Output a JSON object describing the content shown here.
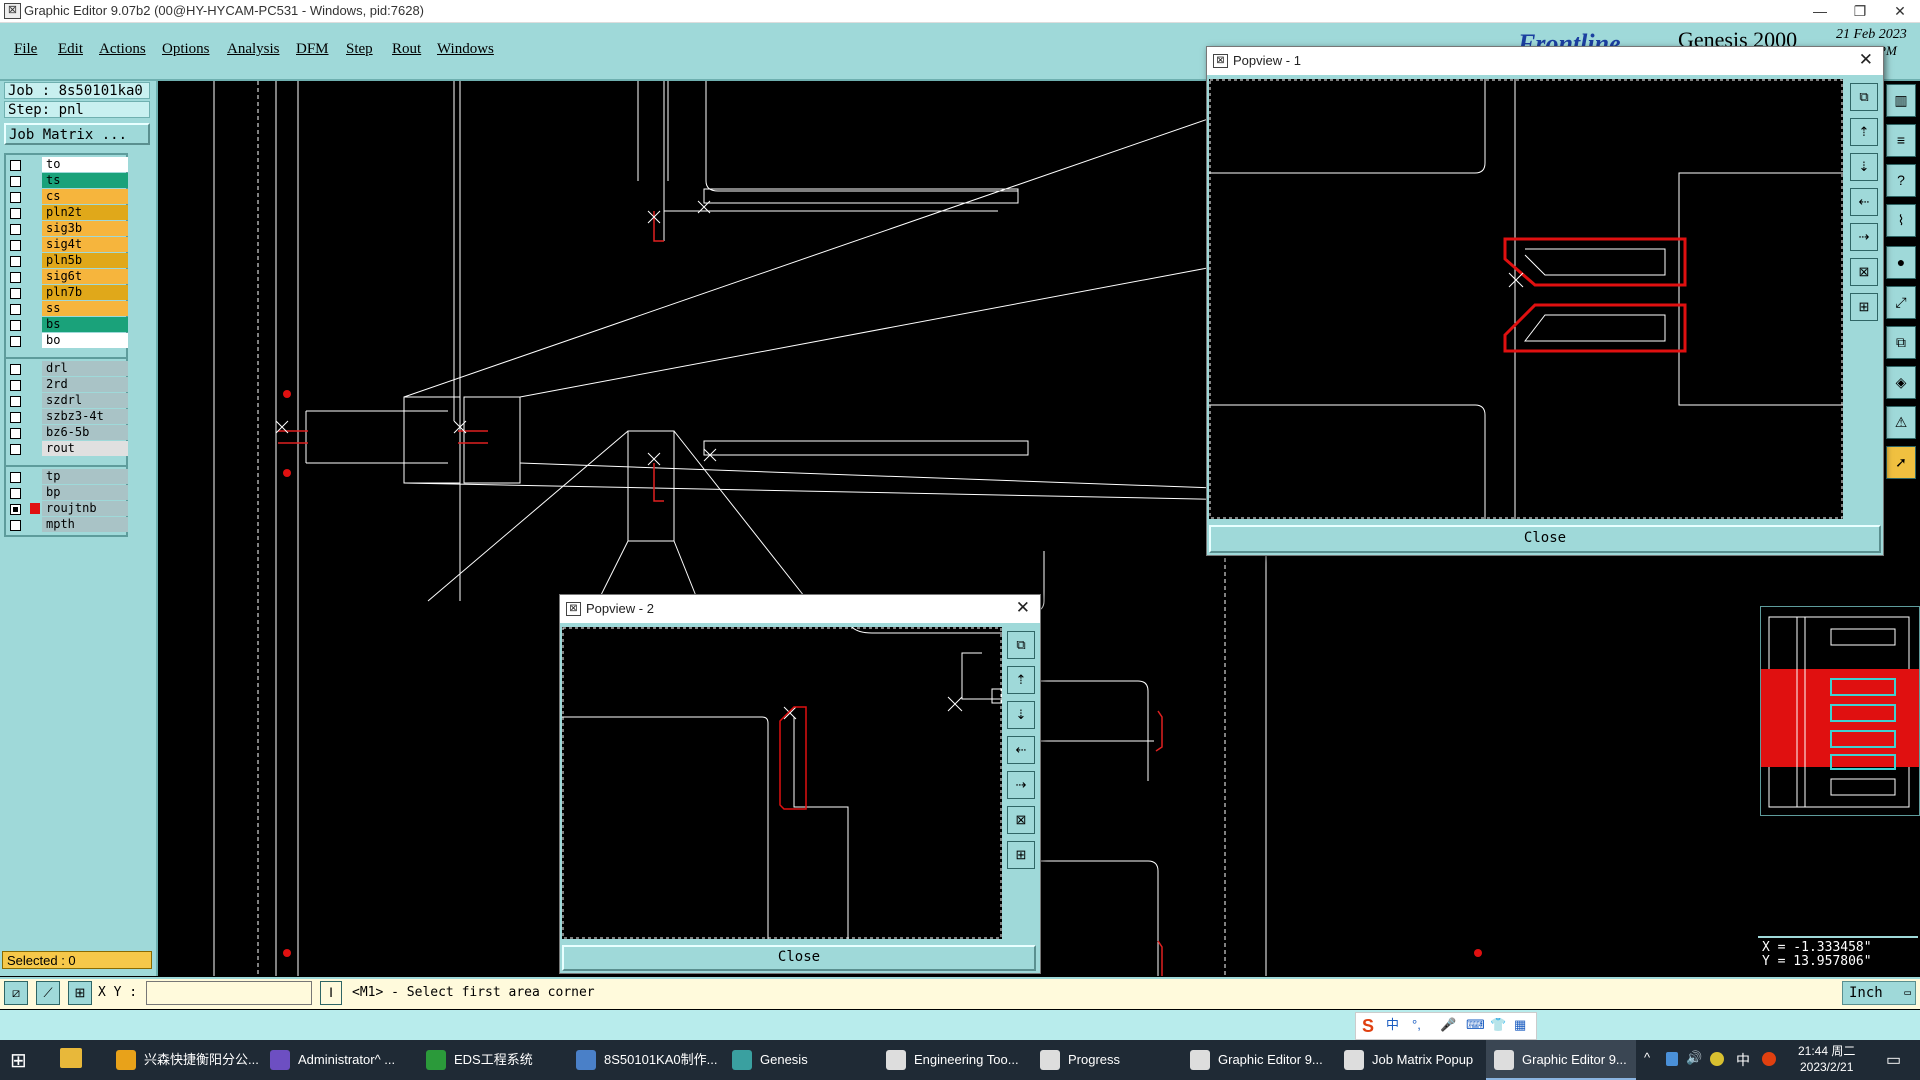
{
  "window": {
    "title": "Graphic Editor 9.07b2 (00@HY-HYCAM-PC531 - Windows, pid:7628)"
  },
  "menu": [
    "File",
    "Edit",
    "Actions",
    "Options",
    "Analysis",
    "DFM",
    "Step",
    "Rout",
    "Windows"
  ],
  "brand": {
    "logo_text": "Frontline",
    "product": "Genesis 2000",
    "date": "21 Feb 2023",
    "time_partial": "PM"
  },
  "job": {
    "job_label": "Job : 8s50101ka0",
    "step_label": "Step: pnl",
    "matrix_button": "Job Matrix ..."
  },
  "layers_board": [
    {
      "name": "to",
      "color": "#ffffff"
    },
    {
      "name": "ts",
      "color": "#1aa27a"
    },
    {
      "name": "cs",
      "color": "#f6b53d"
    },
    {
      "name": "pln2t",
      "color": "#e0a81a"
    },
    {
      "name": "sig3b",
      "color": "#f6b53d"
    },
    {
      "name": "sig4t",
      "color": "#f6b53d"
    },
    {
      "name": "pln5b",
      "color": "#e0a81a"
    },
    {
      "name": "sig6t",
      "color": "#f6b53d"
    },
    {
      "name": "pln7b",
      "color": "#e0a81a"
    },
    {
      "name": "ss",
      "color": "#f6b53d"
    },
    {
      "name": "bs",
      "color": "#1aa27a"
    },
    {
      "name": "bo",
      "color": "#ffffff"
    }
  ],
  "layers_drill": [
    {
      "name": "drl",
      "color": "#a9c3c6"
    },
    {
      "name": "2rd",
      "color": "#a9c3c6"
    },
    {
      "name": "szdrl",
      "color": "#a9c3c6"
    },
    {
      "name": "szbz3-4t",
      "color": "#a9c3c6"
    },
    {
      "name": "bz6-5b",
      "color": "#a9c3c6"
    },
    {
      "name": "rout",
      "color": "#e0e0e0"
    }
  ],
  "layers_misc": [
    {
      "name": "tp",
      "color": "#a9c3c6",
      "on": false
    },
    {
      "name": "bp",
      "color": "#a9c3c6",
      "on": false
    },
    {
      "name": "roujtnb",
      "color": "#a9c3c6",
      "on": true,
      "swatch": "#e01010"
    },
    {
      "name": "mpth",
      "color": "#a9c3c6",
      "on": false
    }
  ],
  "selected_label": "Selected : 0",
  "popup1": {
    "title": "Popview - 1",
    "close_label": "Close"
  },
  "popup2": {
    "title": "Popview - 2",
    "close_label": "Close"
  },
  "coords": {
    "x": "X = -1.333458\"",
    "y": "Y = 13.957806\""
  },
  "status": {
    "xy_label": "X Y :",
    "xy_value": "",
    "prompt": "<M1> - Select first area corner",
    "units": "Inch"
  },
  "ime": {
    "items": [
      "中",
      "°,",
      "🎤",
      "⌨",
      "👕",
      "▦"
    ]
  },
  "taskbar": {
    "tasks": [
      {
        "label": "兴森快捷衡阳分公...",
        "color": "#e8a21a"
      },
      {
        "label": "Administrator^ ...",
        "color": "#6d4fc2"
      },
      {
        "label": "EDS工程系统",
        "color": "#2b9a3a"
      },
      {
        "label": "8S50101KA0制作...",
        "color": "#4a80c8"
      },
      {
        "label": "Genesis",
        "color": "#3aa0a0"
      },
      {
        "label": "Engineering Too...",
        "color": "#dddddd"
      },
      {
        "label": "Progress",
        "color": "#dddddd"
      },
      {
        "label": "Graphic Editor 9...",
        "color": "#dddddd"
      },
      {
        "label": "Job Matrix Popup",
        "color": "#dddddd"
      },
      {
        "label": "Graphic Editor 9...",
        "color": "#dddddd"
      }
    ],
    "tray_lang": "中",
    "clock_time": "21:44 周二",
    "clock_date": "2023/2/21"
  }
}
